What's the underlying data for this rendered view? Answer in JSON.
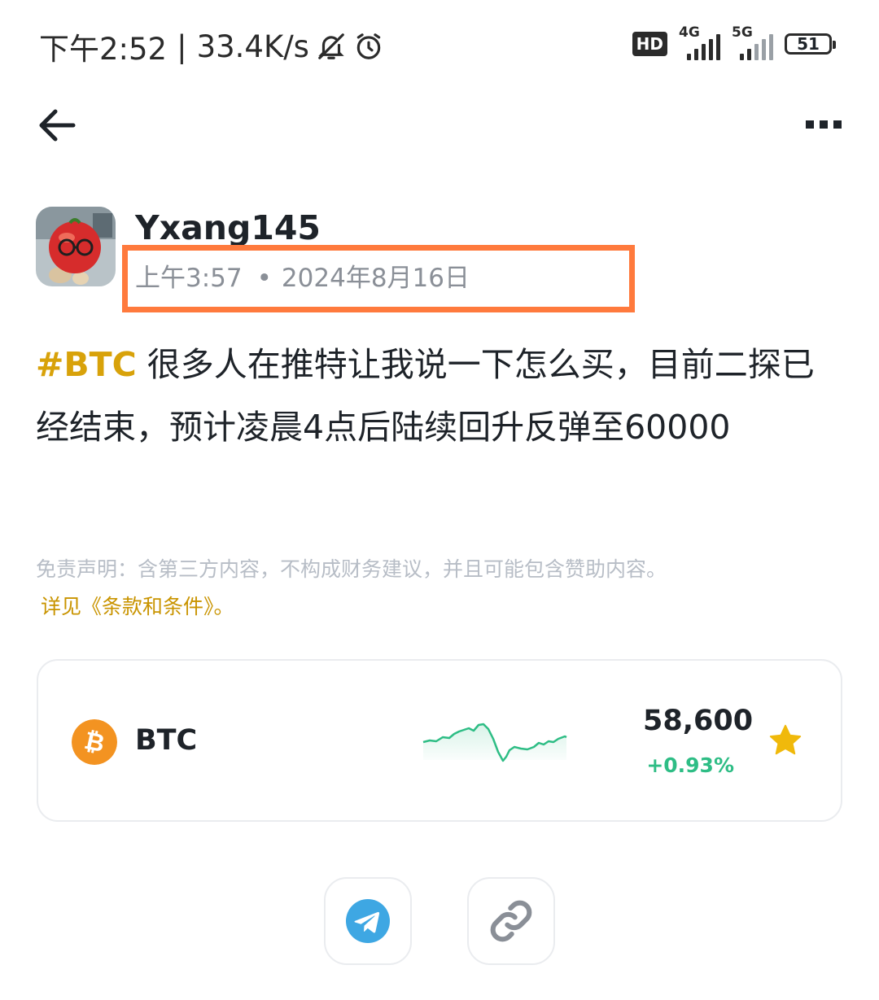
{
  "status_bar": {
    "time": "下午2:52",
    "divider": "|",
    "speed": "33.4K/s",
    "hd_label": "HD",
    "network_1": "4G",
    "network_2": "5G",
    "battery": "51"
  },
  "post": {
    "author": "Yxang145",
    "time": "上午3:57",
    "separator": "•",
    "date": "2024年8月16日",
    "hashtag": "#BTC",
    "content": " 很多人在推特让我说一下怎么买，目前二探已经结束，预计凌晨4点后陆续回升反弹至60000",
    "disclaimer": "免责声明：含第三方内容，不构成财务建议，并且可能包含赞助内容。",
    "terms_link": "详见《条款和条件》。"
  },
  "ticker": {
    "symbol": "BTC",
    "price": "58,600",
    "change": "+0.93%",
    "change_color": "#2ebd85",
    "coin_color": "#f39321",
    "watchlist_starred": true
  },
  "colors": {
    "hashtag": "#d8a20a",
    "highlight_box": "#ff7a3d",
    "star": "#f0b90b",
    "telegram": "#3ea7e3"
  },
  "share": {
    "buttons": [
      "telegram-icon",
      "link-icon"
    ]
  }
}
